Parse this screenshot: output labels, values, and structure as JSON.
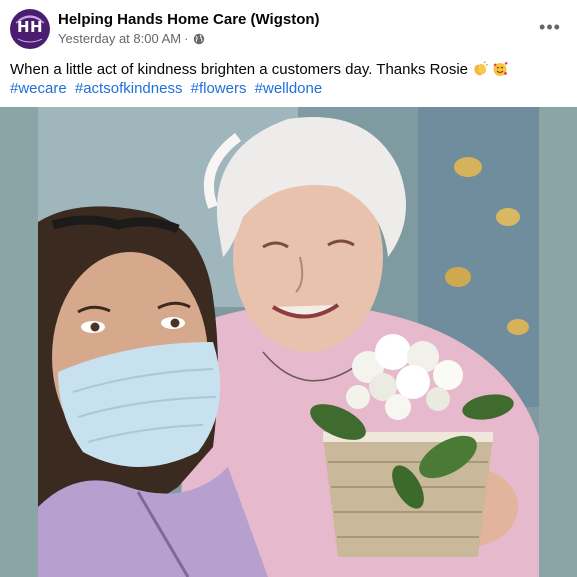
{
  "post": {
    "page_name": "Helping Hands Home Care (Wigston)",
    "avatar_initials": "HH",
    "timestamp": "Yesterday at 8:00 AM",
    "separator": "·",
    "more_label": "•••",
    "privacy_icon": "globe-icon",
    "caption": "When a little act of kindness brighten a customers day. Thanks Rosie",
    "caption_emojis": [
      "clapping-hands-icon",
      "smiling-face-with-hearts-icon"
    ],
    "hashtags": [
      "#wecare",
      "#actsofkindness",
      "#flowers",
      "#welldone"
    ]
  },
  "colors": {
    "avatar_bg": "#4a1d6e",
    "hashtag": "#216fdb",
    "photo_bg": "#8ba5a6"
  }
}
